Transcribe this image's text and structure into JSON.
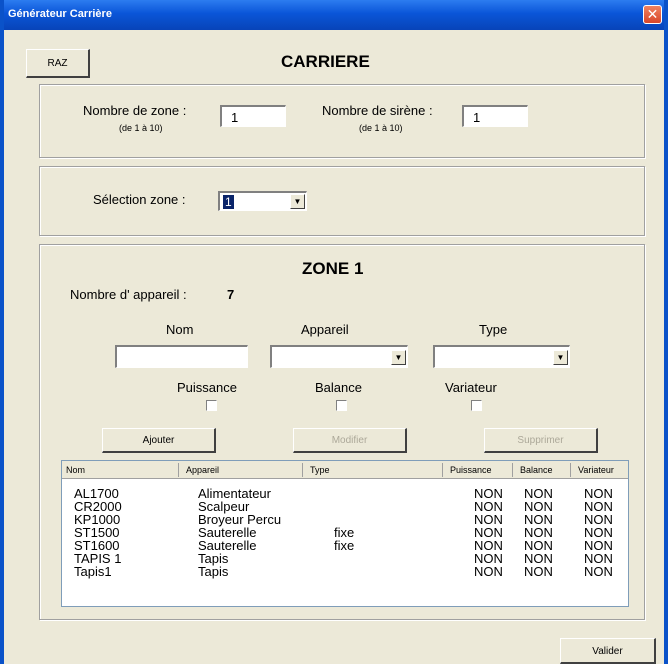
{
  "window": {
    "title": "Générateur Carrière",
    "close_glyph": "✕"
  },
  "toolbar": {
    "raz_label": "RAZ"
  },
  "header": {
    "title": "CARRIERE"
  },
  "config": {
    "zone_label": "Nombre de zone :",
    "zone_hint": "(de 1 à 10)",
    "zone_value": "1",
    "siren_label": "Nombre de sirène :",
    "siren_hint": "(de 1 à 10)",
    "siren_value": "1"
  },
  "selection": {
    "label": "Sélection zone :",
    "value": "1"
  },
  "zone": {
    "title": "ZONE 1",
    "count_label": "Nombre d' appareil :",
    "count_value": "7",
    "nom_label": "Nom",
    "appareil_label": "Appareil",
    "type_label": "Type",
    "puissance_label": "Puissance",
    "balance_label": "Balance",
    "variateur_label": "Variateur",
    "ajouter_label": "Ajouter",
    "modifier_label": "Modifier",
    "supprimer_label": "Supprimer"
  },
  "table": {
    "columns": [
      "Nom",
      "Appareil",
      "Type",
      "Puissance",
      "Balance",
      "Variateur"
    ],
    "rows": [
      [
        "AL1700",
        "Alimentateur",
        "",
        "NON",
        "NON",
        "NON"
      ],
      [
        "CR2000",
        "Scalpeur",
        "",
        "NON",
        "NON",
        "NON"
      ],
      [
        "KP1000",
        "Broyeur Percu",
        "",
        "NON",
        "NON",
        "NON"
      ],
      [
        "ST1500",
        "Sauterelle",
        "fixe",
        "NON",
        "NON",
        "NON"
      ],
      [
        "ST1600",
        "Sauterelle",
        "fixe",
        "NON",
        "NON",
        "NON"
      ],
      [
        "TAPIS 1",
        "Tapis",
        "",
        "NON",
        "NON",
        "NON"
      ],
      [
        "Tapis1",
        "Tapis",
        "",
        "NON",
        "NON",
        "NON"
      ]
    ]
  },
  "footer": {
    "valider_label": "Valider"
  }
}
